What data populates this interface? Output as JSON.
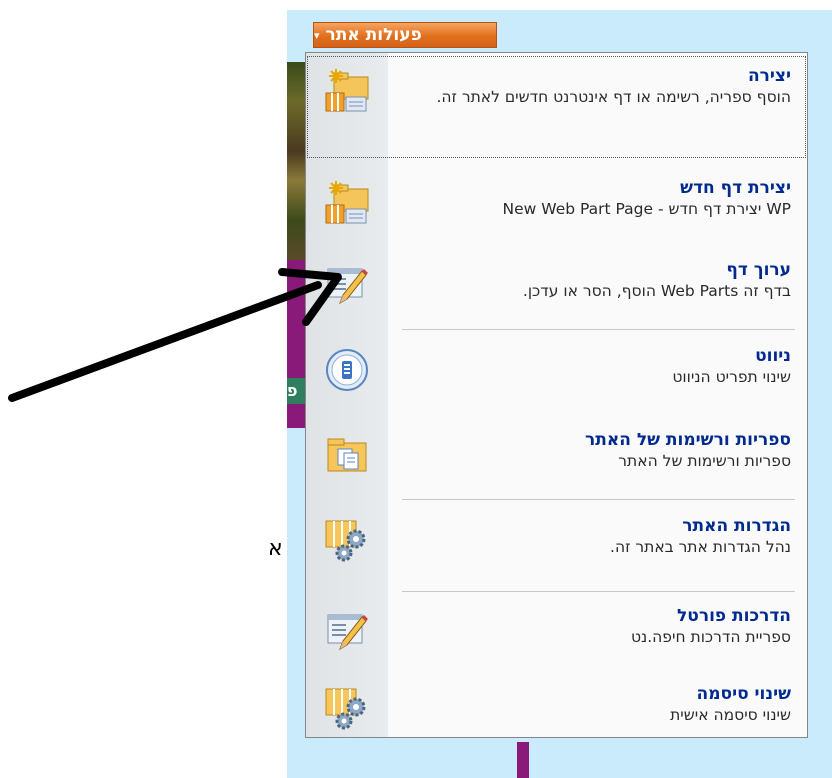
{
  "site_actions": {
    "label": "פעולות אתר",
    "caret": "▾",
    "color": "#e1701d"
  },
  "background": {
    "side_text": "פ",
    "letter": "א"
  },
  "menu": {
    "items": [
      {
        "title": "יצירה",
        "desc": "הוסף ספריה, רשימה או דף אינטרנט חדשים לאתר זה.",
        "icon": "create-icon"
      },
      {
        "title": "יצירת דף חדש",
        "desc": "WP יצירת דף חדש - New Web Part Page",
        "icon": "create-page-icon"
      },
      {
        "title": "ערוך דף",
        "desc": "בדף זה Web Parts הוסף, הסר או עדכן.",
        "icon": "edit-page-icon"
      },
      {
        "title": "ניווט",
        "desc": "שינוי תפריט הניווט",
        "icon": "navigation-icon"
      },
      {
        "title": "ספריות ורשימות של האתר",
        "desc": "ספריות ורשימות של האתר",
        "icon": "libraries-icon"
      },
      {
        "title": "הגדרות האתר",
        "desc": "נהל הגדרות אתר באתר זה.",
        "icon": "settings-icon"
      },
      {
        "title": "הדרכות פורטל",
        "desc": "ספריית הדרכות חיפה.נט",
        "icon": "training-icon"
      },
      {
        "title": "שינוי סיסמה",
        "desc": "שינוי סיסמה אישית",
        "icon": "password-icon"
      }
    ]
  },
  "colors": {
    "title": "#002a8f",
    "menu_bg": "#fafafa",
    "page_bg": "#c9ebfb"
  }
}
